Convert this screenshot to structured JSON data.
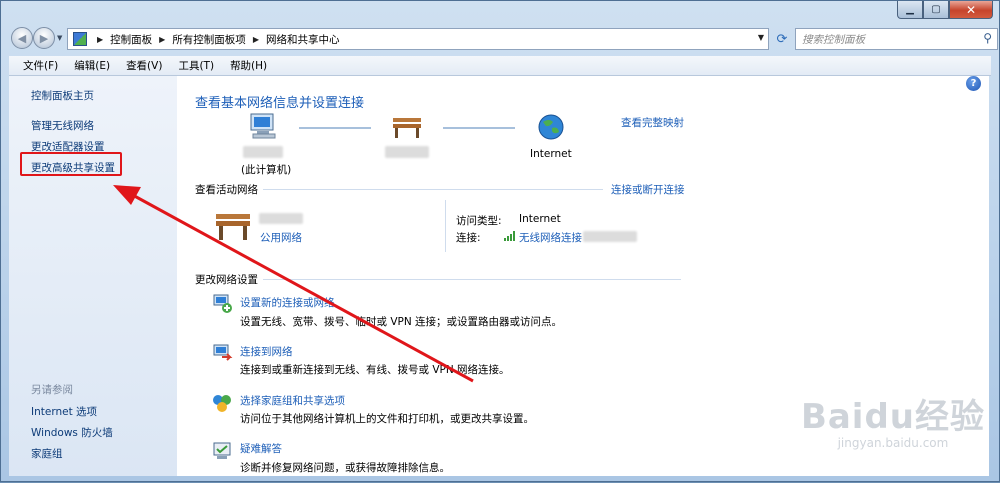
{
  "window": {
    "caption_buttons": [
      "minimize-icon",
      "maximize-icon",
      "close-icon"
    ]
  },
  "address_bar": {
    "breadcrumbs": [
      "控制面板",
      "所有控制面板项",
      "网络和共享中心"
    ]
  },
  "search": {
    "placeholder": "搜索控制面板"
  },
  "menu": [
    "文件(F)",
    "编辑(E)",
    "查看(V)",
    "工具(T)",
    "帮助(H)"
  ],
  "sidebar": {
    "home": "控制面板主页",
    "items": [
      "管理无线网络",
      "更改适配器设置",
      "更改高级共享设置"
    ],
    "see_also_head": "另请参阅",
    "see_also": [
      "Internet 选项",
      "Windows 防火墙",
      "家庭组"
    ]
  },
  "main": {
    "title": "查看基本网络信息并设置连接",
    "full_map_link": "查看完整映射",
    "map": {
      "computer_label": "(此计算机)",
      "internet_label": "Internet"
    },
    "active_networks": {
      "heading": "查看活动网络",
      "connect_link": "连接或断开连接",
      "network_type": "公用网络",
      "access_type_label": "访问类型:",
      "access_type_value": "Internet",
      "connection_label": "连接:",
      "connection_value": "无线网络连接"
    },
    "change_settings": {
      "heading": "更改网络设置",
      "tasks": [
        {
          "title": "设置新的连接或网络",
          "desc": "设置无线、宽带、拨号、临时或 VPN 连接；或设置路由器或访问点。"
        },
        {
          "title": "连接到网络",
          "desc": "连接到或重新连接到无线、有线、拨号或 VPN 网络连接。"
        },
        {
          "title": "选择家庭组和共享选项",
          "desc": "访问位于其他网络计算机上的文件和打印机，或更改共享设置。"
        },
        {
          "title": "疑难解答",
          "desc": "诊断并修复网络问题，或获得故障排除信息。"
        }
      ]
    }
  },
  "watermark": {
    "main": "Baidu经验",
    "sub": "jingyan.baidu.com"
  },
  "colors": {
    "link": "#1e5fb8",
    "annotation": "#e0161a"
  }
}
